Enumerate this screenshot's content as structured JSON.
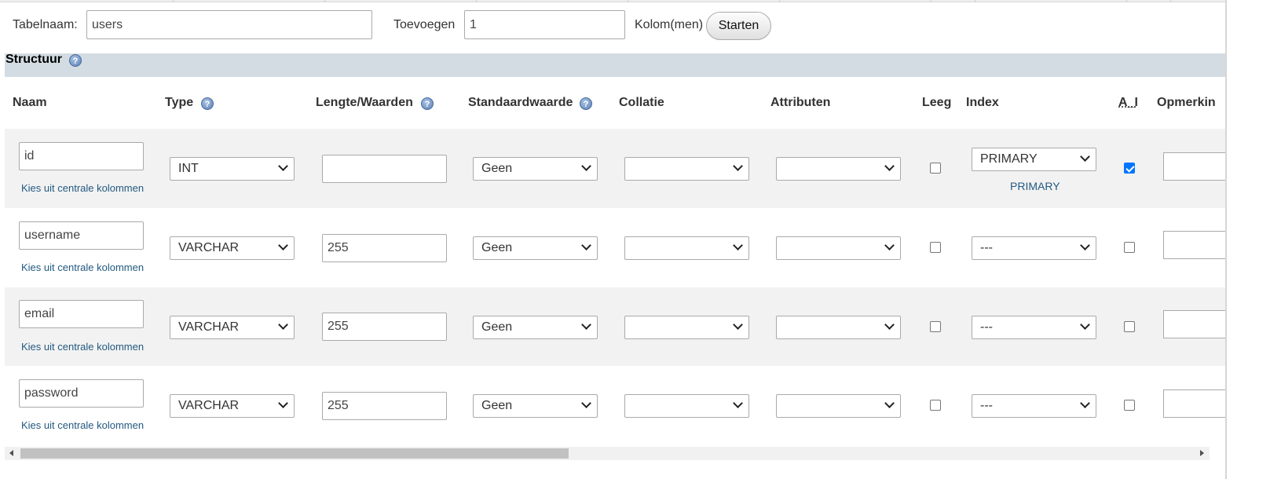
{
  "form": {
    "table_name_label": "Tabelnaam:",
    "table_name_value": "users",
    "add_label": "Toevoegen",
    "add_value": "1",
    "columns_label": "Kolom(men)",
    "go_button": "Starten"
  },
  "structure": {
    "title": "Structuur"
  },
  "headers": {
    "name": "Naam",
    "type": "Type",
    "length": "Lengte/Waarden",
    "default": "Standaardwaarde",
    "collation": "Collatie",
    "attributes": "Attributen",
    "null": "Leeg",
    "index": "Index",
    "ai": "A_I",
    "comments": "Opmerkin"
  },
  "central_columns_link": "Kies uit centrale kolommen",
  "rows": [
    {
      "name": "id",
      "type": "INT",
      "length": "",
      "default": "Geen",
      "collation": "",
      "attributes": "",
      "null": false,
      "index": "PRIMARY",
      "index_sub": "PRIMARY",
      "ai": true,
      "comment": ""
    },
    {
      "name": "username",
      "type": "VARCHAR",
      "length": "255",
      "default": "Geen",
      "collation": "",
      "attributes": "",
      "null": false,
      "index": "---",
      "index_sub": "",
      "ai": false,
      "comment": ""
    },
    {
      "name": "email",
      "type": "VARCHAR",
      "length": "255",
      "default": "Geen",
      "collation": "",
      "attributes": "",
      "null": false,
      "index": "---",
      "index_sub": "",
      "ai": false,
      "comment": ""
    },
    {
      "name": "password",
      "type": "VARCHAR",
      "length": "255",
      "default": "Geen",
      "collation": "",
      "attributes": "",
      "null": false,
      "index": "---",
      "index_sub": "",
      "ai": false,
      "comment": ""
    }
  ],
  "icons": {
    "help": "help-icon",
    "dropdown": "chevron-down-icon",
    "scroll_left": "scroll-left-arrow-icon",
    "scroll_right": "scroll-right-arrow-icon"
  },
  "colors": {
    "structure_bar": "#d3dce3",
    "link": "#235a81",
    "checkbox_checked": "#0075ff",
    "row_stripe": "#f2f2f2"
  }
}
